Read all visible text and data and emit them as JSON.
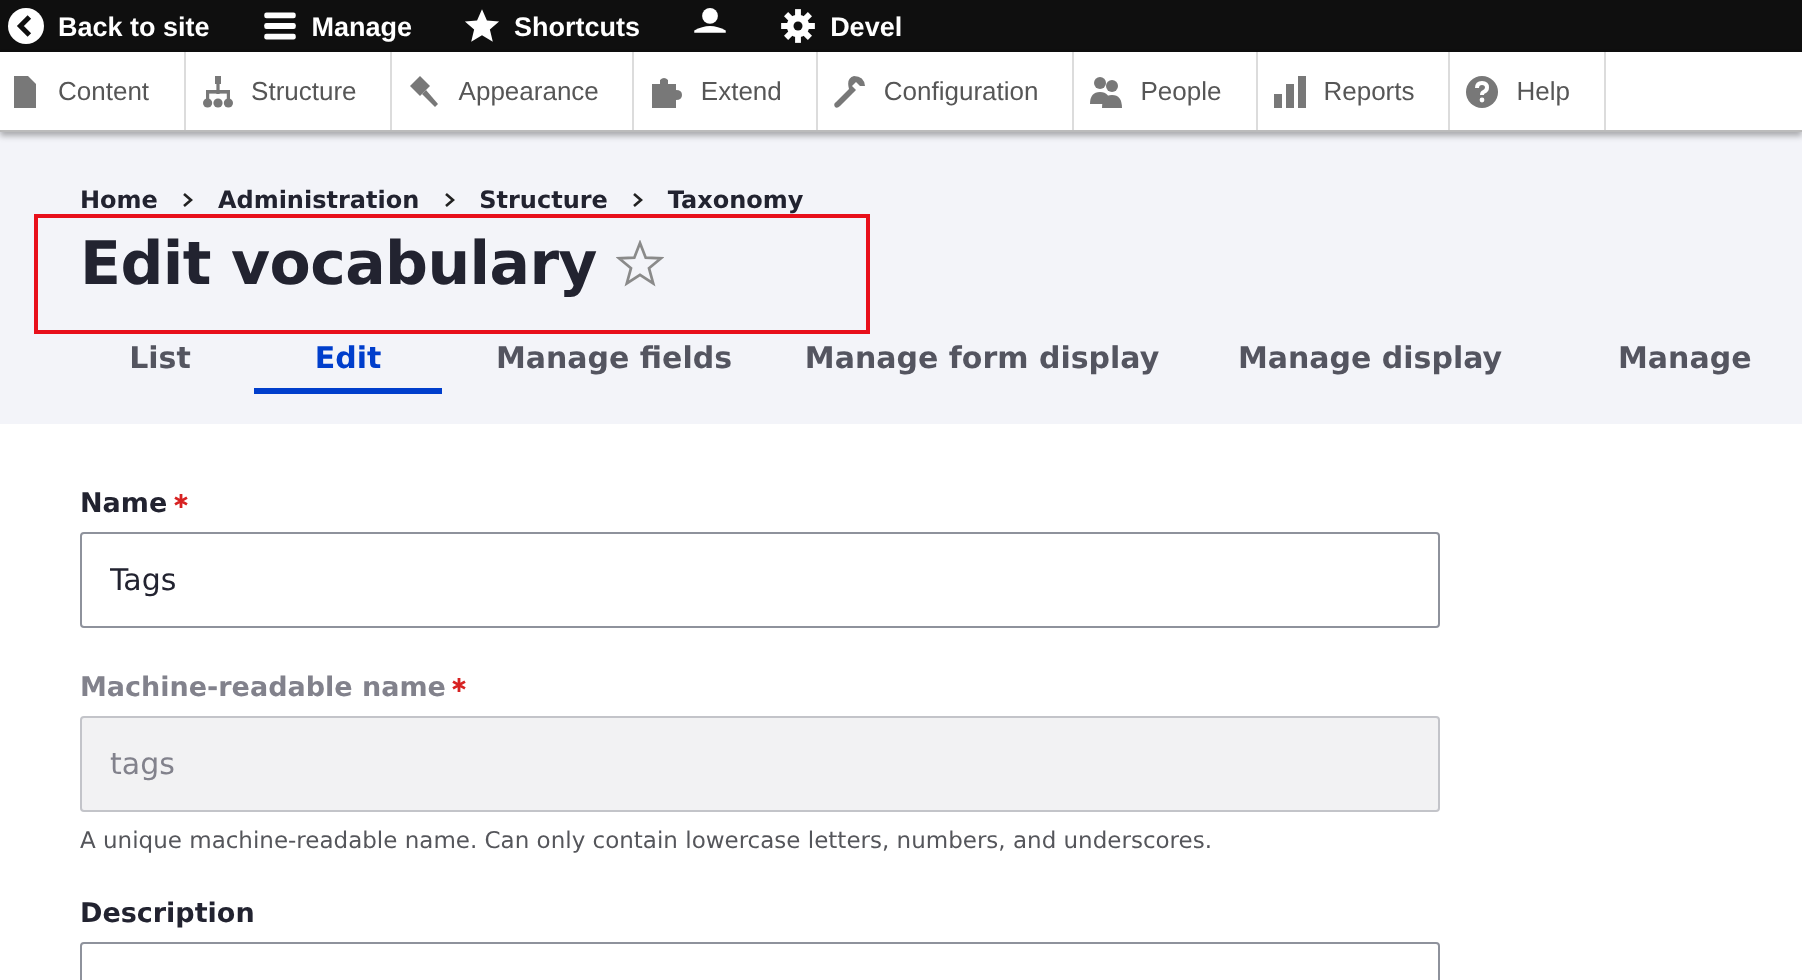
{
  "toolbar": {
    "items": [
      {
        "kind": "link",
        "label": "Back to site"
      },
      {
        "kind": "link",
        "label": "Manage"
      },
      {
        "kind": "link",
        "label": "Shortcuts"
      },
      {
        "kind": "icon"
      },
      {
        "kind": "link",
        "label": "Devel"
      }
    ]
  },
  "admin_menu": {
    "items": [
      {
        "label": "Content"
      },
      {
        "label": "Structure"
      },
      {
        "label": "Appearance"
      },
      {
        "label": "Extend"
      },
      {
        "label": "Configuration"
      },
      {
        "label": "People"
      },
      {
        "label": "Reports"
      },
      {
        "label": "Help"
      }
    ]
  },
  "breadcrumb": [
    "Home",
    "Administration",
    "Structure",
    "Taxonomy"
  ],
  "page_title": {
    "text": "Edit vocabulary",
    "highlighted": true,
    "starred": false
  },
  "tabs": [
    {
      "label": "List",
      "selected": false
    },
    {
      "label": "Edit",
      "selected": true
    },
    {
      "label": "Manage fields",
      "selected": false
    },
    {
      "label": "Manage form display",
      "selected": false
    },
    {
      "label": "Manage display",
      "selected": false
    },
    {
      "label": "Manage",
      "selected": false
    }
  ],
  "fields": [
    {
      "label": "Name",
      "required": true,
      "disabled": false,
      "value": "Tags"
    },
    {
      "label": "Machine-readable name",
      "required": true,
      "disabled": true,
      "value": "tags",
      "description": "A unique machine-readable name. Can only contain lowercase letters, numbers, and underscores."
    },
    {
      "label": "Description",
      "required": false,
      "disabled": false
    }
  ]
}
